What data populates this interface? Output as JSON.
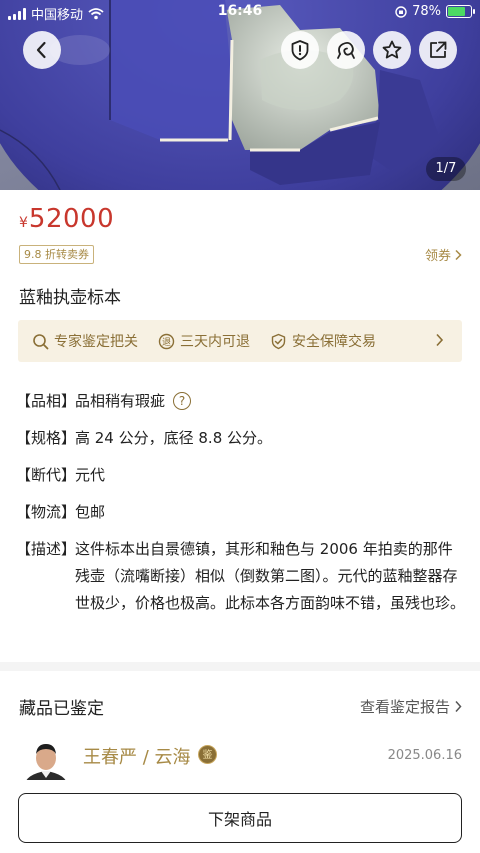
{
  "status_bar": {
    "carrier": "中国移动",
    "time": "16:46",
    "battery": "78%"
  },
  "gallery": {
    "indicator": "1/7"
  },
  "product": {
    "currency": "¥",
    "price": "52000",
    "coupon_tag": "9.8 折转卖券",
    "get_coupon": "领券",
    "title": "蓝釉执壶标本"
  },
  "guarantees": [
    {
      "icon": "search-icon",
      "label": "专家鉴定把关"
    },
    {
      "icon": "return-icon",
      "label": "三天内可退"
    },
    {
      "icon": "shield-check-icon",
      "label": "安全保障交易"
    }
  ],
  "attributes": [
    {
      "key": "【品相】",
      "value": "品相稍有瑕疵"
    },
    {
      "key": "【规格】",
      "value": "高 24 公分，底径 8.8 公分。"
    },
    {
      "key": "【断代】",
      "value": "元代"
    },
    {
      "key": "【物流】",
      "value": "包邮"
    },
    {
      "key": "【描述】",
      "value": "这件标本出自景德镇，其形和釉色与 2006 年拍卖的那件残壶（流嘴断接）相似（倒数第二图）。元代的蓝釉整器存世极少，价格也极高。此标本各方面韵味不错，虽残也珍。"
    }
  ],
  "appraisal": {
    "section_title": "藏品已鉴定",
    "report_link": "查看鉴定报告",
    "appraiser_name": "王春严 / 云海",
    "badge_text": "鉴",
    "date": "2025.06.16"
  },
  "actions": {
    "delist": "下架商品"
  },
  "colors": {
    "price": "#c8372d",
    "gold": "#a78a46",
    "guarantee_bg": "#f7f1e3",
    "glaze_blue": "#3f3f9e"
  }
}
